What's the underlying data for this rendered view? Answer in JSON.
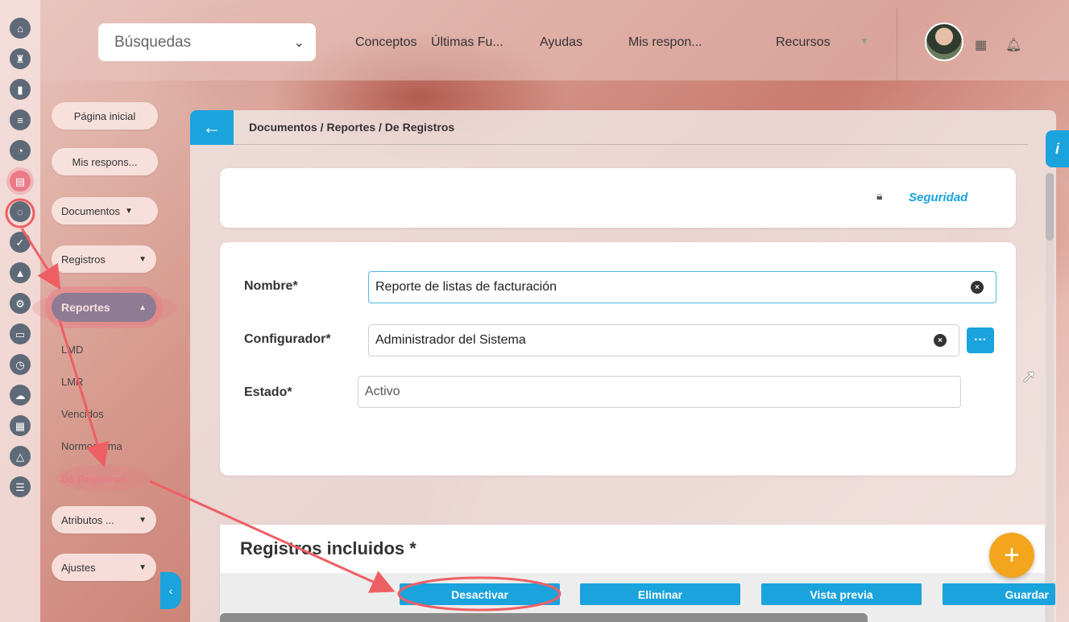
{
  "topbar": {
    "search_select": "Búsquedas",
    "nav": [
      "Conceptos",
      "Últimas Fu...",
      "Ayudas",
      "Mis respon...",
      "Recursos"
    ]
  },
  "sidebar": {
    "items": [
      {
        "label": "Página inicial"
      },
      {
        "label": "Mis respons..."
      },
      {
        "label": "Documentos"
      },
      {
        "label": "Registros"
      },
      {
        "label": "Reportes"
      },
      {
        "label": "Atributos ..."
      },
      {
        "label": "Ajustes"
      }
    ],
    "subitems": [
      "LMD",
      "LMR",
      "Vencidos",
      "Normograma",
      "De Registros"
    ]
  },
  "breadcrumb": "Documentos / Reportes / De Registros",
  "security_label": "Seguridad",
  "form": {
    "nombre_label": "Nombre*",
    "nombre_value": "Reporte de listas de facturación",
    "configurador_label": "Configurador*",
    "configurador_value": "Administrador del Sistema",
    "estado_label": "Estado*",
    "estado_value": "Activo"
  },
  "section_title": "Registros incluidos *",
  "actions": [
    "Desactivar",
    "Eliminar",
    "Vista previa",
    "Guardar"
  ],
  "colors": {
    "accent": "#1aa3dc",
    "highlight": "#e97a86",
    "fab": "#f3a51d"
  }
}
